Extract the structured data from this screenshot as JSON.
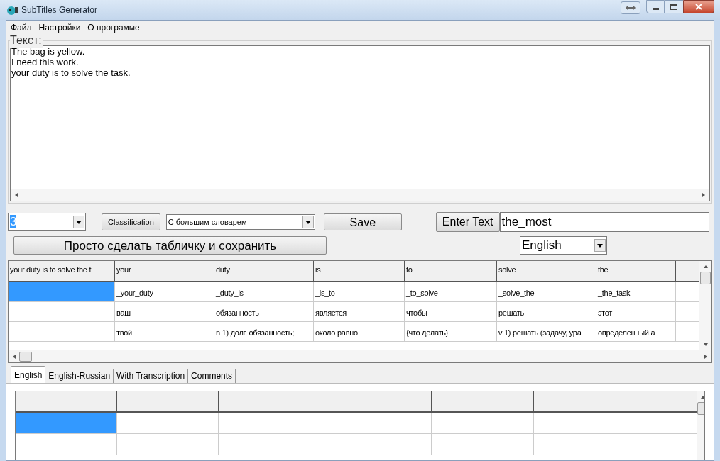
{
  "window": {
    "title": "SubTitles Generator"
  },
  "menu": [
    "Файл",
    "Настройки",
    "О программе"
  ],
  "text_group": {
    "label": "Текст:",
    "lines": [
      "The bag is yellow.",
      "I need this work.",
      "your duty is to solve the task."
    ]
  },
  "controls": {
    "count_combo": "3",
    "classification_button": "Classification",
    "dictionary_combo": "С большим словарем",
    "save_button": "Save",
    "enter_text_button": "Enter Text",
    "text_field": "the_most",
    "make_table_button": "Просто сделать табличку и сохранить",
    "language_combo": "English"
  },
  "grid": {
    "columns": [
      "your duty is to solve the t",
      "your",
      "duty",
      "is",
      "to",
      "solve",
      "the"
    ],
    "rows": [
      {
        "selected": true,
        "cells": [
          "",
          "_your_duty",
          "_duty_is",
          "_is_to",
          "_to_solve",
          "_solve_the",
          "_the_task"
        ]
      },
      {
        "selected": false,
        "cells": [
          "",
          "ваш",
          "обязанность",
          "является",
          "чтобы",
          "решать",
          "этот"
        ]
      },
      {
        "selected": false,
        "cells": [
          "",
          "твой",
          "n 1) долг, обязанность;",
          "около равно",
          "{что делать}",
          "v 1) решать (задачу, ура",
          "определенный а"
        ]
      }
    ]
  },
  "tabs": [
    {
      "label": "English",
      "selected": true
    },
    {
      "label": "English-Russian",
      "selected": false
    },
    {
      "label": "With Transcription",
      "selected": false
    },
    {
      "label": "Comments",
      "selected": false
    }
  ],
  "bottom_grid": {
    "rows": [
      {
        "selected": true
      },
      {
        "selected": false
      }
    ]
  }
}
